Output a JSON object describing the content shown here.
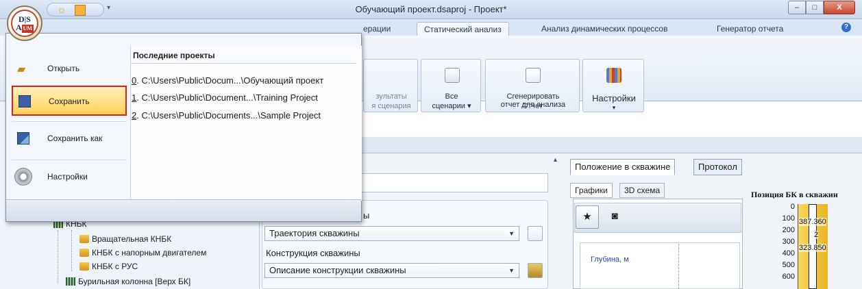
{
  "window": {
    "title": "Обучающий проект.dsaproj - Проект*",
    "logo_text_top": "D|S",
    "logo_text_bottom_a": "A",
    "logo_text_bottom_um": "UM",
    "min": "–",
    "max": "□",
    "close": "X"
  },
  "ribbon": {
    "tabs": [
      "ерации",
      "Статический анализ",
      "Анализ динамических процессов",
      "Генератор отчета"
    ],
    "active_tab": "Статический анализ",
    "help": "?",
    "results_label_1": "зультаты",
    "results_label_2": "я сценария",
    "all_scenarios_1": "Все",
    "all_scenarios_2": "сценарии ▾",
    "gen_report_1": "Сгенерировать",
    "gen_report_2": "отчет для анализа",
    "group_report": "Отчет",
    "settings": "Настройки",
    "settings_arrow": "▾"
  },
  "app_menu": {
    "items": [
      {
        "label": "Открыть",
        "icon": "folder-open-icon"
      },
      {
        "label": "Сохранить",
        "icon": "save-icon"
      },
      {
        "label": "Сохранить как",
        "icon": "save-as-icon"
      },
      {
        "label": "Настройки",
        "icon": "gears-icon"
      }
    ],
    "recent_heading": "Последние проекты",
    "recent": [
      {
        "num": "0",
        "path": ". C:\\Users\\Public\\Docum...\\Обучающий проект"
      },
      {
        "num": "1",
        "path": ". C:\\Users\\Public\\Document...\\Training Project"
      },
      {
        "num": "2",
        "path": ". C:\\Users\\Public\\Documents...\\Sample Project"
      }
    ]
  },
  "tree": {
    "partial": "КНБК",
    "items": [
      "Вращательная КНБК",
      "КНБК с напорным двигателем",
      "КНБК с РУС",
      "Бурильная колонна [Верх БК]"
    ]
  },
  "center": {
    "partial_label": "ы",
    "trajectory_combo": "Траектория скважины",
    "construction_label": "Конструкция скважины",
    "construction_combo": "Описание конструкции скважины"
  },
  "right": {
    "tabs": [
      "Положение в скважине",
      "Протокол"
    ],
    "subtabs": [
      "Графики",
      "3D схема"
    ],
    "depth_label": "Глубина, м",
    "ruler_title": "Позиция БК в скважин",
    "ruler_ticks": [
      "0",
      "100",
      "200",
      "300",
      "400",
      "500",
      "600"
    ],
    "ruler_values": [
      "387.360",
      "2",
      "323.850"
    ]
  }
}
